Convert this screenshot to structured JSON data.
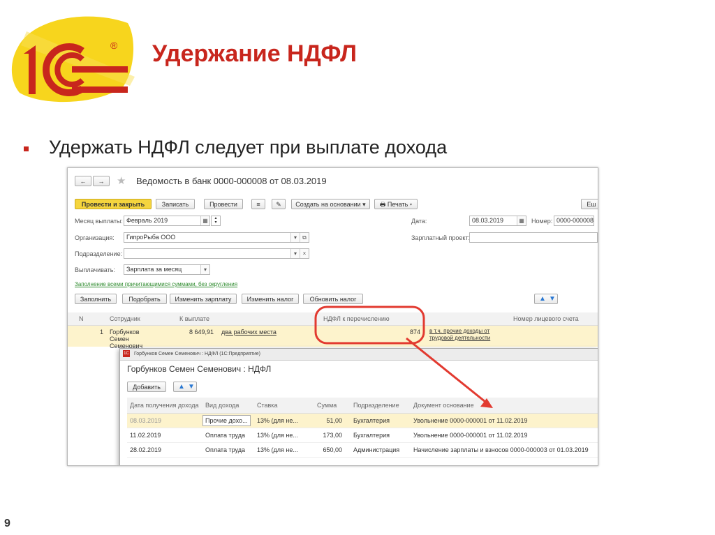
{
  "slide": {
    "title": "Удержание НДФЛ",
    "bullet": "Удержать НДФЛ следует при выплате дохода",
    "page_number": "9",
    "accent_color": "#c8261d",
    "logo_text": "1С",
    "logo_registered": "®"
  },
  "window": {
    "nav_back": "←",
    "nav_forward": "→",
    "star_icon": "star-icon",
    "title": "Ведомость в банк 0000-000008 от 08.03.2019",
    "toolbar": {
      "post_close": "Провести и закрыть",
      "save": "Записать",
      "post": "Провести",
      "create_based": "Создать на основании",
      "print": "Печать",
      "more": "Еш"
    },
    "form": {
      "month_label": "Месяц выплаты:",
      "month_value": "Февраль 2019",
      "date_label": "Дата:",
      "date_value": "08.03.2019",
      "number_label": "Номер:",
      "number_value": "0000-000008",
      "org_label": "Организация:",
      "org_value": "ГипроРыба ООО",
      "project_label": "Зарплатный проект:",
      "project_value": "",
      "dept_label": "Подразделение:",
      "dept_value": "",
      "pay_label": "Выплачивать:",
      "pay_value": "Зарплата за месяц",
      "fill_link": "Заполнение всеми причитающимися суммами, без округления"
    },
    "table_toolbar": {
      "fill": "Заполнить",
      "pick": "Подобрать",
      "change_salary": "Изменить зарплату",
      "change_tax": "Изменить налог",
      "update_tax": "Обновить налог"
    },
    "columns": [
      "N",
      "Сотрудник",
      "К выплате",
      "НДФЛ к перечислению",
      "Номер лицевого счета"
    ],
    "row": {
      "n": "1",
      "employee": "Горбунков Семен Семенович",
      "to_pay": "8 649,91",
      "to_pay_link": "два рабочих места",
      "ndfl": "874",
      "ndfl_link": "в т.ч. прочие доходы от трудовой деятельности",
      "account": ""
    }
  },
  "subwindow": {
    "titlebar": "Горбунков Семен Семенович : НДФЛ (1С:Предприятие)",
    "title": "Горбунков Семен Семенович : НДФЛ",
    "add": "Добавить",
    "columns": [
      "Дата получения дохода",
      "Вид дохода",
      "Ставка",
      "Сумма",
      "Подразделение",
      "Документ основание"
    ],
    "rows": [
      {
        "date": "08.03.2019",
        "kind": "Прочие дохо...",
        "rate": "13% (для не...",
        "sum": "51,00",
        "dept": "Бухгалтерия",
        "doc": "Увольнение 0000-000001 от 11.02.2019"
      },
      {
        "date": "11.02.2019",
        "kind": "Оплата труда",
        "rate": "13% (для не...",
        "sum": "173,00",
        "dept": "Бухгалтерия",
        "doc": "Увольнение 0000-000001 от 11.02.2019"
      },
      {
        "date": "28.02.2019",
        "kind": "Оплата труда",
        "rate": "13% (для не...",
        "sum": "650,00",
        "dept": "Администрация",
        "doc": "Начисление зарплаты и взносов 0000-000003 от 01.03.2019"
      }
    ]
  }
}
